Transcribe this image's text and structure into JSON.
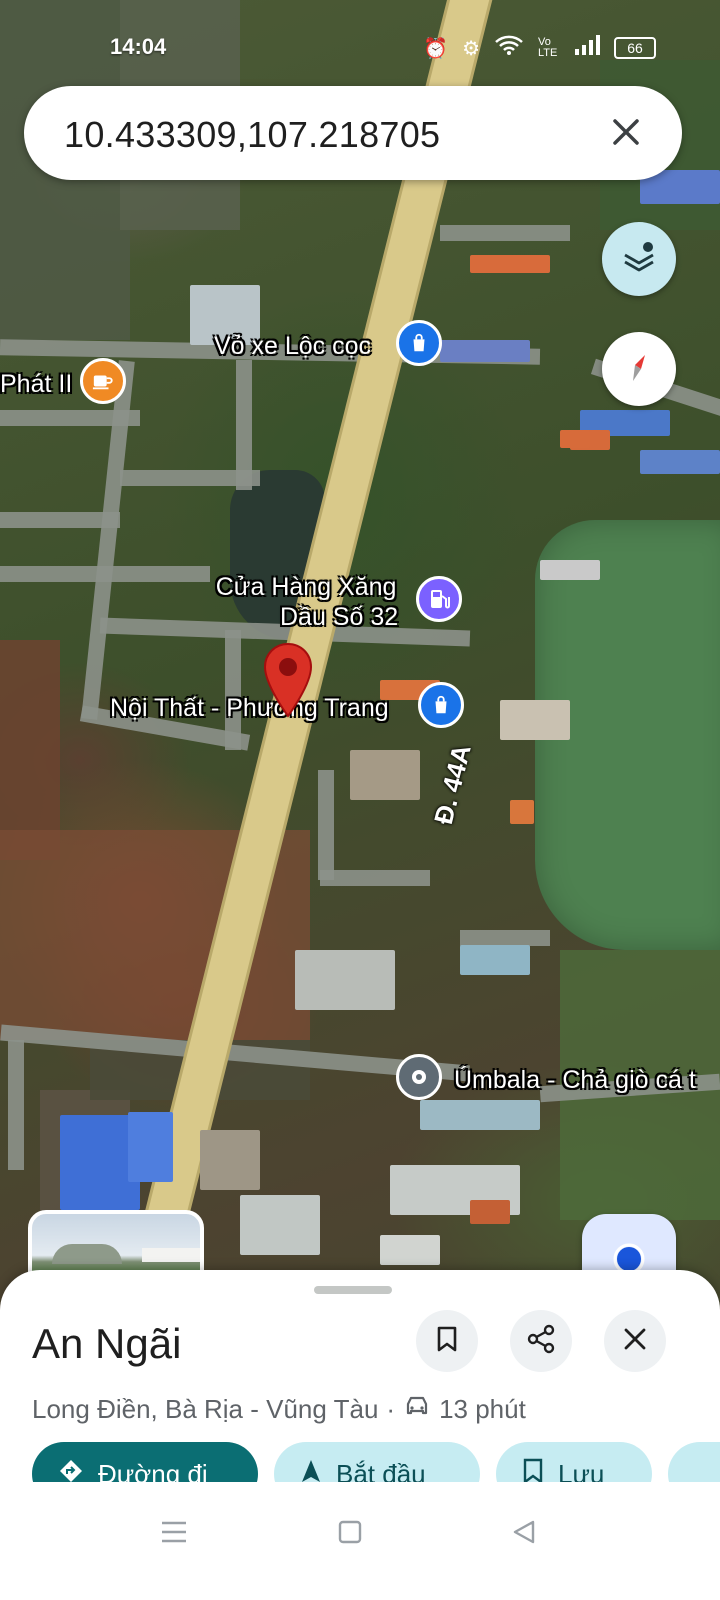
{
  "status_bar": {
    "time": "14:04",
    "network": "Vo LTE",
    "battery": "66",
    "icons": [
      "alarm-icon",
      "settings-icon",
      "wifi-icon",
      "signal-icon",
      "battery-icon"
    ]
  },
  "search": {
    "value": "10.433309,107.218705",
    "close_icon": "close-icon"
  },
  "map": {
    "buttons": [
      "layers-icon",
      "compass-icon",
      "my-location-icon"
    ],
    "road_label": "Đ. 44A",
    "places": [
      {
        "name": "Vỏ xe Lộc cọc",
        "icon": "shopping-bag-icon",
        "color": "#1a73e8"
      },
      {
        "name": "Phát II",
        "icon": "cafe-icon",
        "color": "#f08a24"
      },
      {
        "name": "Cửa Hàng Xăng Dầu Số 32",
        "line1": "Cửa Hàng Xăng",
        "line2": "Dầu Số 32",
        "icon": "gas-station-icon",
        "color": "#7b61ff"
      },
      {
        "name": "Nội Thất - Phương Trang",
        "icon": "shopping-bag-icon",
        "color": "#1a73e8"
      },
      {
        "name": "Úmbala - Chả giò cá t",
        "icon": "place-icon",
        "color": "#5f6b74"
      }
    ],
    "dropped_pin": "red-pin-icon"
  },
  "sheet": {
    "title": "An Ngãi",
    "subtitle_location": "Long Điền, Bà Rịa - Vũng Tàu",
    "separator": "·",
    "drive_time": "13 phút",
    "actions": {
      "directions": "Đường đi",
      "start": "Bắt đầu",
      "save": "Lưu"
    }
  },
  "colors": {
    "accent": "#0b6e73",
    "chip_light": "#c6ecf2",
    "pin_red": "#d93025"
  }
}
